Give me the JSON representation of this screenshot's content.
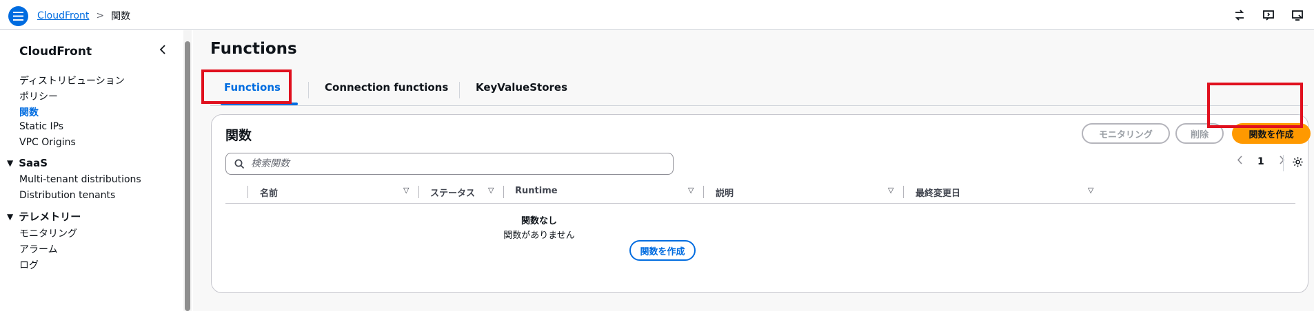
{
  "topbar": {
    "breadcrumb_root": "CloudFront",
    "breadcrumb_separator": ">",
    "breadcrumb_current": "関数",
    "icons": [
      "menu-icon",
      "shortcut-icon",
      "feedback-icon",
      "screen-icon"
    ]
  },
  "sidebar": {
    "title": "CloudFront",
    "items_top": [
      {
        "label": "ディストリビューション"
      },
      {
        "label": "ポリシー"
      },
      {
        "label": "関数",
        "active": true
      },
      {
        "label": "Static IPs"
      },
      {
        "label": "VPC Origins"
      }
    ],
    "section_saas": {
      "label": "SaaS",
      "items": [
        {
          "label": "Multi-tenant distributions"
        },
        {
          "label": "Distribution tenants"
        }
      ]
    },
    "section_telemetry": {
      "label": "テレメトリー",
      "items": [
        {
          "label": "モニタリング"
        },
        {
          "label": "アラーム"
        },
        {
          "label": "ログ"
        }
      ]
    }
  },
  "main": {
    "page_title": "Functions",
    "tabs": [
      {
        "label": "Functions",
        "active": true
      },
      {
        "label": "Connection functions"
      },
      {
        "label": "KeyValueStores"
      }
    ],
    "panel": {
      "title": "関数",
      "btn_monitoring": "モニタリング",
      "btn_delete": "削除",
      "btn_create": "関数を作成",
      "search_placeholder": "検索関数",
      "page_number": "1",
      "columns": [
        {
          "label": "名前"
        },
        {
          "label": "ステータス"
        },
        {
          "label": "Runtime"
        },
        {
          "label": "説明"
        },
        {
          "label": "最終変更日"
        }
      ],
      "empty_title": "関数なし",
      "empty_message": "関数がありません",
      "empty_create_button": "関数を作成"
    }
  },
  "colors": {
    "accent": "#006ce0",
    "primary_button": "#ff9900",
    "highlight_box": "#e0101e"
  }
}
